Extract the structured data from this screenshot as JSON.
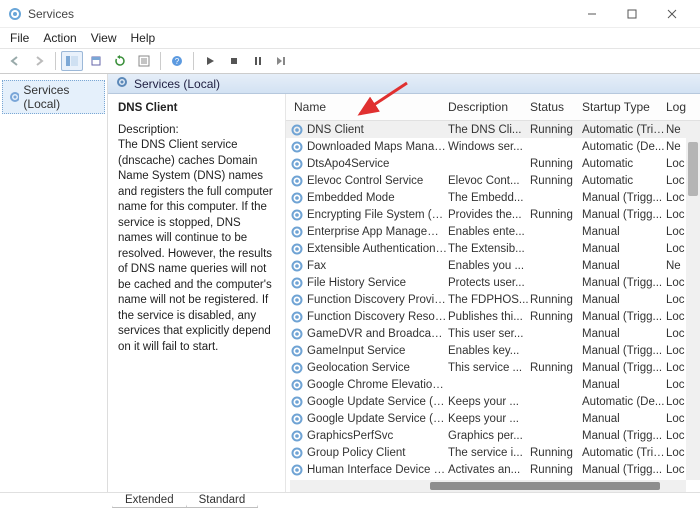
{
  "window": {
    "title": "Services"
  },
  "menu": [
    "File",
    "Action",
    "View",
    "Help"
  ],
  "left_pane": {
    "root_label": "Services (Local)"
  },
  "pane_header": "Services (Local)",
  "detail": {
    "selected": "DNS Client",
    "desc_label": "Description:",
    "desc_text": "The DNS Client service (dnscache) caches Domain Name System (DNS) names and registers the full computer name for this computer. If the service is stopped, DNS names will continue to be resolved. However, the results of DNS name queries will not be cached and the computer's name will not be registered. If the service is disabled, any services that explicitly depend on it will fail to start."
  },
  "columns": {
    "name": "Name",
    "description": "Description",
    "status": "Status",
    "startup": "Startup Type",
    "logon": "Log"
  },
  "rows": [
    {
      "name": "DNS Client",
      "desc": "The DNS Cli...",
      "status": "Running",
      "startup": "Automatic (Trig...",
      "logon": "Ne"
    },
    {
      "name": "Downloaded Maps Manager",
      "desc": "Windows ser...",
      "status": "",
      "startup": "Automatic (De...",
      "logon": "Ne"
    },
    {
      "name": "DtsApo4Service",
      "desc": "",
      "status": "Running",
      "startup": "Automatic",
      "logon": "Loc"
    },
    {
      "name": "Elevoc Control Service",
      "desc": "Elevoc Cont...",
      "status": "Running",
      "startup": "Automatic",
      "logon": "Loc"
    },
    {
      "name": "Embedded Mode",
      "desc": "The Embedd...",
      "status": "",
      "startup": "Manual (Trigg...",
      "logon": "Loc"
    },
    {
      "name": "Encrypting File System (EFS)",
      "desc": "Provides the...",
      "status": "Running",
      "startup": "Manual (Trigg...",
      "logon": "Loc"
    },
    {
      "name": "Enterprise App Managemen...",
      "desc": "Enables ente...",
      "status": "",
      "startup": "Manual",
      "logon": "Loc"
    },
    {
      "name": "Extensible Authentication Pr...",
      "desc": "The Extensib...",
      "status": "",
      "startup": "Manual",
      "logon": "Loc"
    },
    {
      "name": "Fax",
      "desc": "Enables you ...",
      "status": "",
      "startup": "Manual",
      "logon": "Ne"
    },
    {
      "name": "File History Service",
      "desc": "Protects user...",
      "status": "",
      "startup": "Manual (Trigg...",
      "logon": "Loc"
    },
    {
      "name": "Function Discovery Provider ...",
      "desc": "The FDPHOS...",
      "status": "Running",
      "startup": "Manual",
      "logon": "Loc"
    },
    {
      "name": "Function Discovery Resourc...",
      "desc": "Publishes thi...",
      "status": "Running",
      "startup": "Manual (Trigg...",
      "logon": "Loc"
    },
    {
      "name": "GameDVR and Broadcast Us...",
      "desc": "This user ser...",
      "status": "",
      "startup": "Manual",
      "logon": "Loc"
    },
    {
      "name": "GameInput Service",
      "desc": "Enables key...",
      "status": "",
      "startup": "Manual (Trigg...",
      "logon": "Loc"
    },
    {
      "name": "Geolocation Service",
      "desc": "This service ...",
      "status": "Running",
      "startup": "Manual (Trigg...",
      "logon": "Loc"
    },
    {
      "name": "Google Chrome Elevation Se...",
      "desc": "",
      "status": "",
      "startup": "Manual",
      "logon": "Loc"
    },
    {
      "name": "Google Update Service (gup...",
      "desc": "Keeps your ...",
      "status": "",
      "startup": "Automatic (De...",
      "logon": "Loc"
    },
    {
      "name": "Google Update Service (gup...",
      "desc": "Keeps your ...",
      "status": "",
      "startup": "Manual",
      "logon": "Loc"
    },
    {
      "name": "GraphicsPerfSvc",
      "desc": "Graphics per...",
      "status": "",
      "startup": "Manual (Trigg...",
      "logon": "Loc"
    },
    {
      "name": "Group Policy Client",
      "desc": "The service i...",
      "status": "Running",
      "startup": "Automatic (Trig...",
      "logon": "Loc"
    },
    {
      "name": "Human Interface Device Serv...",
      "desc": "Activates an...",
      "status": "Running",
      "startup": "Manual (Trigg...",
      "logon": "Loc"
    }
  ],
  "tabs": {
    "extended": "Extended",
    "standard": "Standard"
  }
}
